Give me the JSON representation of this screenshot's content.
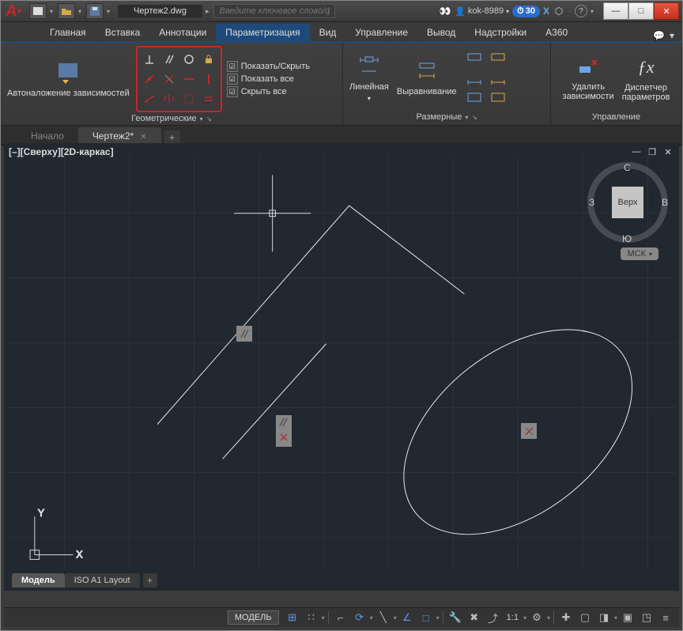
{
  "title": {
    "doc": "Чертеж2.dwg",
    "search_placeholder": "Введите ключевое слово/фразу",
    "user": "kok-8989",
    "days": "30"
  },
  "tabs": [
    "Главная",
    "Вставка",
    "Аннотации",
    "Параметризация",
    "Вид",
    "Управление",
    "Вывод",
    "Надстройки",
    "A360"
  ],
  "active_tab": "Параметризация",
  "ribbon": {
    "geom": {
      "title": "Геометрические",
      "auto": "Автоналожение зависимостей",
      "show": "Показать/Скрыть",
      "show_all": "Показать все",
      "hide_all": "Скрыть все"
    },
    "dim": {
      "title": "Размерные",
      "linear": "Линейная",
      "align": "Выравнивание"
    },
    "manage": {
      "title": "Управление",
      "delete": "Удалить\nзависимости",
      "manager": "Диспетчер\nпараметров"
    }
  },
  "doc_tabs": {
    "start": "Начало",
    "active": "Чертеж2*"
  },
  "viewport": {
    "label": "[–][Сверху][2D-каркас]"
  },
  "viewcube": {
    "top": "Верх",
    "n": "С",
    "s": "Ю",
    "e": "В",
    "w": "З"
  },
  "wcs": "МСК",
  "layouts": [
    "Модель",
    "ISO A1 Layout"
  ],
  "status": {
    "model": "МОДЕЛЬ",
    "scale": "1:1"
  }
}
